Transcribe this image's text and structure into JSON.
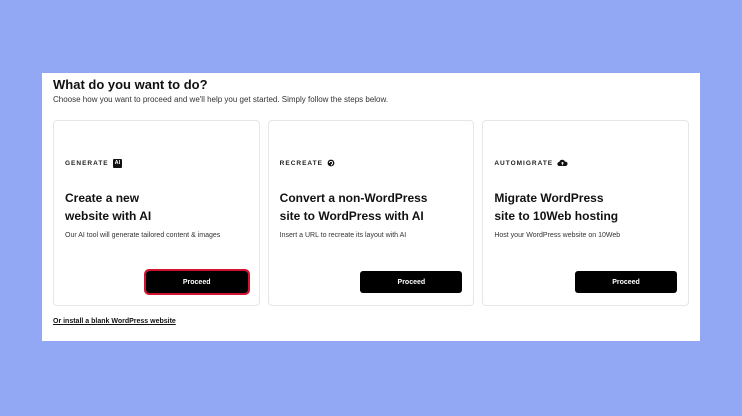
{
  "header": {
    "title": "What do you want to do?",
    "subtitle": "Choose how you want to proceed and we'll help you get started. Simply follow the steps below."
  },
  "cards": [
    {
      "tag": "GENERATE",
      "tag_badge": "AI",
      "title_line1": "Create a new",
      "title_line2": "website with AI",
      "description": "Our AI tool will generate tailored content & images",
      "button_label": "Proceed"
    },
    {
      "tag": "RECREATE",
      "tag_icon": "recreate-icon",
      "title_line1": "Convert a non-WordPress",
      "title_line2": "site to WordPress with AI",
      "description": "Insert a URL to recreate its layout with AI",
      "button_label": "Proceed"
    },
    {
      "tag": "AUTOMIGRATE",
      "tag_icon": "cloud-upload-icon",
      "title_line1": "Migrate WordPress",
      "title_line2": "site to 10Web hosting",
      "description": "Host your WordPress website on 10Web",
      "button_label": "Proceed"
    }
  ],
  "footer": {
    "link_label": "Or install a blank WordPress website"
  },
  "colors": {
    "background": "#93a8f4",
    "button": "#000000",
    "highlight": "#d2122e"
  }
}
